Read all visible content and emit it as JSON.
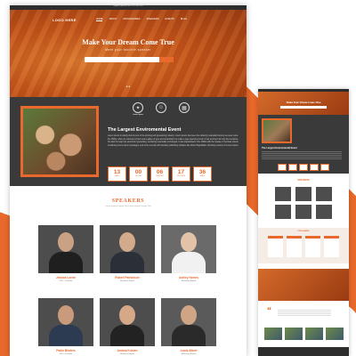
{
  "desktop": {
    "topbar_text": "support@domain.com   +012 345 6789",
    "nav": {
      "logo": "LOGO HERE",
      "items": [
        "HOME",
        "ABOUT",
        "PROGRAMMES",
        "SPEAKERS",
        "EVENTS",
        "BLOG"
      ]
    },
    "hero": {
      "title": "Make Your Dream Come True",
      "subtitle": "Meet your favorite speaker",
      "slide_dots": "● ●"
    },
    "event": {
      "title": "The Largest Enviromental Event",
      "description": "Lorem ipsum is simply dummy text of the printing and typesetting industry. Lorem Ipsum has been the industry's standard dummy text ever since the 1500s, when an unknown printer took a galley of type and scrambled it to make a type specimen book. It has survived not only five centuries, but also the leap into electronic typesetting, remaining essentially unchanged. It was popularised in the 1960s with the release of Letraset sheets containing Lorem Ipsum passages, and more recently with desktop publishing software like Aldus PageMaker including versions of Lorem Ipsum.",
      "icons": [
        {
          "icon": "lightbulb-icon",
          "caption": "Lorem Ipsum"
        },
        {
          "icon": "people-icon",
          "caption": "Lorem Ipsum"
        },
        {
          "icon": "building-icon",
          "caption": "Lorem Ipsum"
        }
      ],
      "counters": [
        {
          "value": "13",
          "label": "DAYS"
        },
        {
          "value": "00",
          "label": "HOURS"
        },
        {
          "value": "06",
          "label": "MINUTES"
        },
        {
          "value": "17",
          "label": "SECONDS"
        },
        {
          "value": "36",
          "label": "SEATS"
        }
      ]
    },
    "speakers": {
      "title": "SPEAKERS",
      "subtitle": "Lorem Ipsum Dummy Text Lorem Ipsum Dummy Text",
      "people": [
        {
          "name": "Jessica Lorem",
          "role": "CEO - Founder"
        },
        {
          "name": "Robert Patrickson",
          "role": "Business Expert"
        },
        {
          "name": "Ashley Homes",
          "role": "Marketing Expert"
        },
        {
          "name": "Pablo Binders",
          "role": "CEO - Founder"
        },
        {
          "name": "Andrea Kristen",
          "role": "Business Expert"
        },
        {
          "name": "Lewis Albert",
          "role": "Marketing Expert"
        }
      ]
    }
  },
  "mobile": {
    "hero_title": "Make Your Dream Come True",
    "event_title": "The Largest Enviromental Event",
    "speakers_title": "SPEAKERS",
    "programs_title": "PROGRAMS"
  },
  "colors": {
    "accent": "#e8692b",
    "dark": "#3a3a3a"
  }
}
